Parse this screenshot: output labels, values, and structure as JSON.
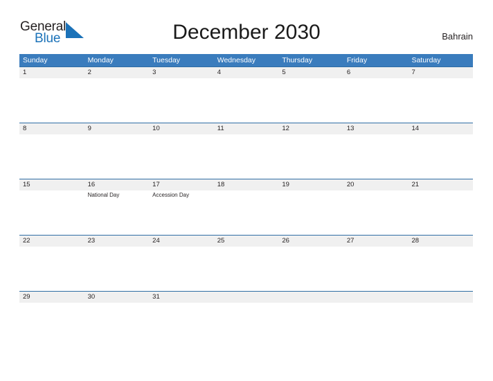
{
  "brand": {
    "name_part1": "General",
    "name_part2": "Blue",
    "triangle_icon": "triangle-logo-icon",
    "accent_color": "#1b72b8"
  },
  "header": {
    "title": "December 2030",
    "location": "Bahrain"
  },
  "calendar": {
    "header_color": "#3a7cbd",
    "band_color": "#f0f0f0",
    "rule_color": "#2e6da4",
    "weekdays": [
      "Sunday",
      "Monday",
      "Tuesday",
      "Wednesday",
      "Thursday",
      "Friday",
      "Saturday"
    ],
    "weeks": [
      [
        {
          "date": "1",
          "event": ""
        },
        {
          "date": "2",
          "event": ""
        },
        {
          "date": "3",
          "event": ""
        },
        {
          "date": "4",
          "event": ""
        },
        {
          "date": "5",
          "event": ""
        },
        {
          "date": "6",
          "event": ""
        },
        {
          "date": "7",
          "event": ""
        }
      ],
      [
        {
          "date": "8",
          "event": ""
        },
        {
          "date": "9",
          "event": ""
        },
        {
          "date": "10",
          "event": ""
        },
        {
          "date": "11",
          "event": ""
        },
        {
          "date": "12",
          "event": ""
        },
        {
          "date": "13",
          "event": ""
        },
        {
          "date": "14",
          "event": ""
        }
      ],
      [
        {
          "date": "15",
          "event": ""
        },
        {
          "date": "16",
          "event": "National Day"
        },
        {
          "date": "17",
          "event": "Accession Day"
        },
        {
          "date": "18",
          "event": ""
        },
        {
          "date": "19",
          "event": ""
        },
        {
          "date": "20",
          "event": ""
        },
        {
          "date": "21",
          "event": ""
        }
      ],
      [
        {
          "date": "22",
          "event": ""
        },
        {
          "date": "23",
          "event": ""
        },
        {
          "date": "24",
          "event": ""
        },
        {
          "date": "25",
          "event": ""
        },
        {
          "date": "26",
          "event": ""
        },
        {
          "date": "27",
          "event": ""
        },
        {
          "date": "28",
          "event": ""
        }
      ],
      [
        {
          "date": "29",
          "event": ""
        },
        {
          "date": "30",
          "event": ""
        },
        {
          "date": "31",
          "event": ""
        },
        {
          "date": "",
          "event": ""
        },
        {
          "date": "",
          "event": ""
        },
        {
          "date": "",
          "event": ""
        },
        {
          "date": "",
          "event": ""
        }
      ]
    ]
  }
}
